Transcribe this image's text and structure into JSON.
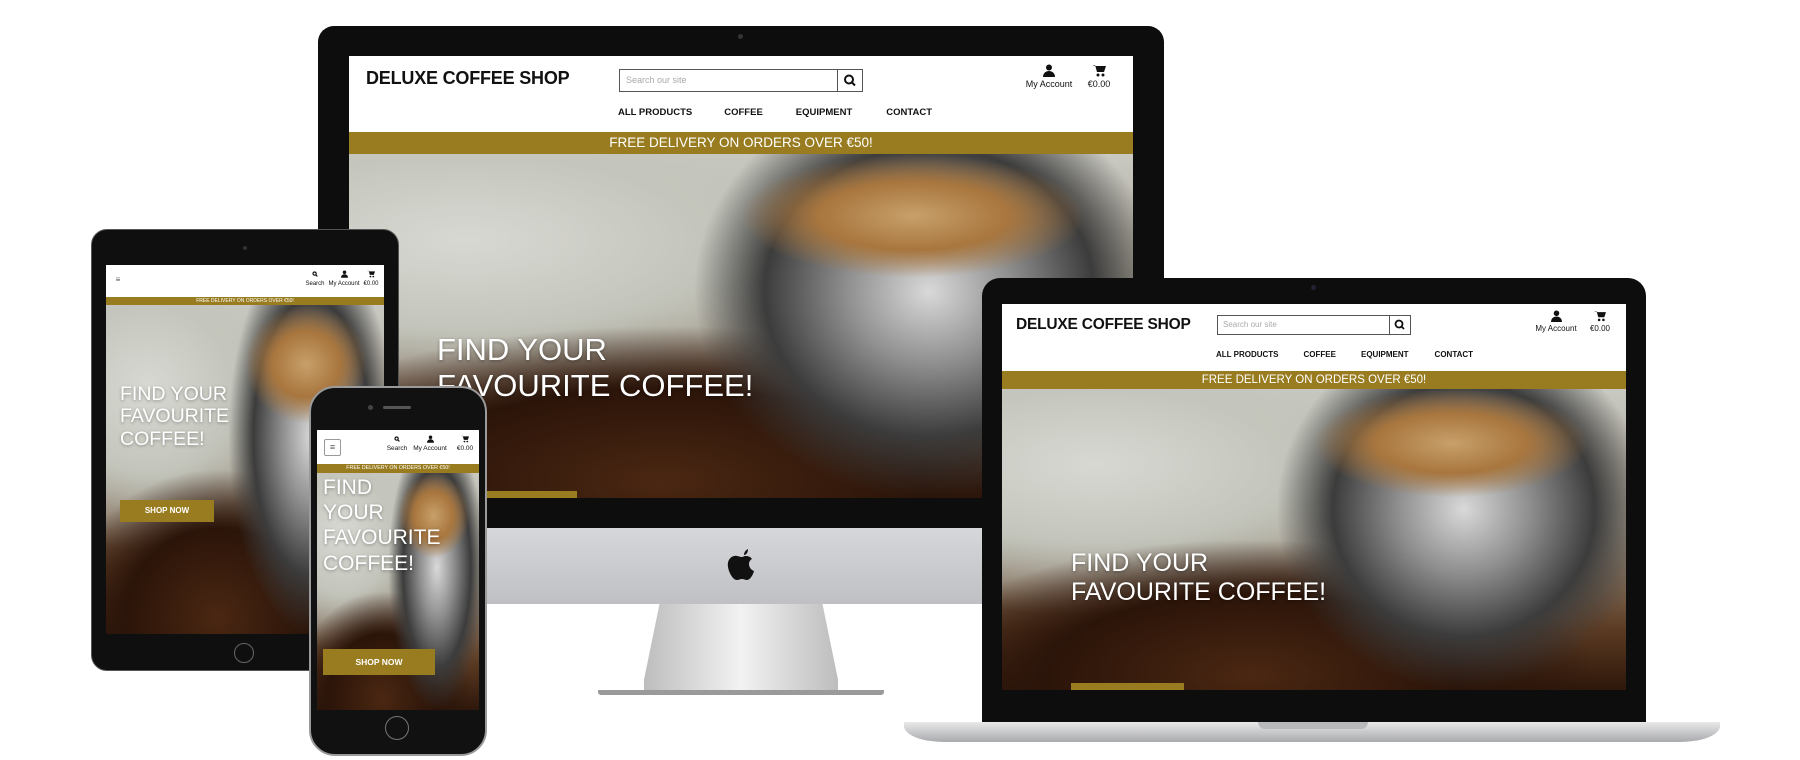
{
  "site": {
    "logo": "DELUXE COFFEE SHOP",
    "search_placeholder": "Search our site",
    "account_label": "My Account",
    "cart_total": "€0.00",
    "search_label": "Search",
    "nav": [
      "ALL PRODUCTS",
      "COFFEE",
      "EQUIPMENT",
      "CONTACT"
    ],
    "banner": "FREE DELIVERY ON ORDERS OVER €50!",
    "hero_title": "FIND YOUR FAVOURITE COFFEE!",
    "hero_lines_desktop": [
      "FIND YOUR",
      "FAVOURITE COFFEE!"
    ],
    "hero_lines_tablet": [
      "FIND YOUR",
      "FAVOURITE",
      "COFFEE!"
    ],
    "hero_lines_phone": [
      "FIND",
      "YOUR",
      "FAVOURITE",
      "COFFEE!"
    ],
    "shop_now": "SHOP NOW"
  },
  "icons": {
    "search": "search-icon",
    "account": "user-icon",
    "cart": "shopping-cart-icon",
    "menu": "hamburger-menu-icon",
    "apple": "apple-logo-icon"
  },
  "colors": {
    "accent": "#997c20",
    "device_body": "#111111",
    "imac_chin": "#c8c9cc"
  }
}
